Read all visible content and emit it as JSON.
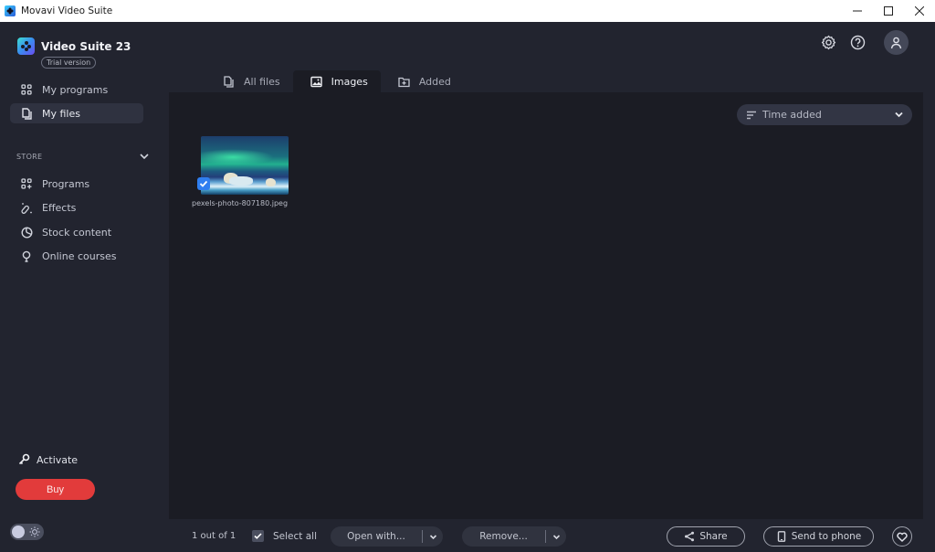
{
  "window": {
    "title": "Movavi Video Suite",
    "controls": {
      "minimize": "–",
      "maximize": "☐",
      "close": "✕"
    }
  },
  "sidebar": {
    "brand": "Video Suite 23",
    "badge": "Trial version",
    "items": [
      {
        "label": "My programs",
        "icon": "grid-icon",
        "active": false
      },
      {
        "label": "My files",
        "icon": "files-icon",
        "active": true
      }
    ],
    "store": {
      "header": "STORE",
      "expanded": true,
      "items": [
        {
          "label": "Programs",
          "icon": "grid-plus-icon"
        },
        {
          "label": "Effects",
          "icon": "magic-wand-icon"
        },
        {
          "label": "Stock content",
          "icon": "stock-icon"
        },
        {
          "label": "Online courses",
          "icon": "lightbulb-icon"
        }
      ]
    },
    "activate": "Activate",
    "buy": "Buy",
    "theme_toggle": {
      "state": "dark",
      "icon": "sun-icon"
    }
  },
  "header": {
    "icons": [
      "gear-icon",
      "help-icon",
      "user-icon"
    ]
  },
  "tabs": [
    {
      "label": "All files",
      "icon": "files-icon",
      "active": false
    },
    {
      "label": "Images",
      "icon": "image-icon",
      "active": true
    },
    {
      "label": "Added",
      "icon": "folder-plus-icon",
      "active": false
    }
  ],
  "sort": {
    "label": "Time added",
    "icon": "sort-icon"
  },
  "files": [
    {
      "name": "pexels-photo-807180.jpeg",
      "selected": true,
      "type": "image"
    }
  ],
  "bottom": {
    "count": "1 out of 1",
    "select_all": "Select all",
    "select_all_checked": true,
    "open_with": "Open with...",
    "remove": "Remove...",
    "share": "Share",
    "send_to_phone": "Send to phone"
  },
  "colors": {
    "accent_blue": "#2f7ef0",
    "buy_red": "#e23b3b",
    "bg_sidebar": "#22242f",
    "bg_main": "#1b1c24"
  }
}
